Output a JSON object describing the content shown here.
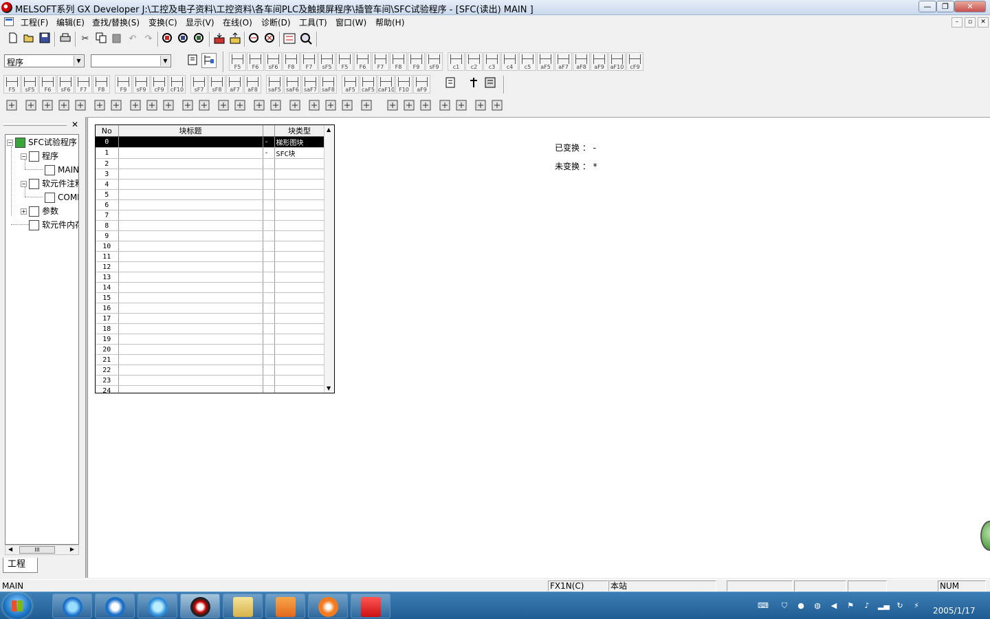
{
  "window": {
    "title": "MELSOFT系列 GX Developer J:\\工控及电子资料\\工控资料\\各车间PLC及触摸屏程序\\插管车间\\SFC试验程序 - [SFC(读出)    MAIN  ]",
    "min": "—",
    "restore": "❐",
    "close": "✕"
  },
  "menu": [
    "工程(F)",
    "编辑(E)",
    "查找/替换(S)",
    "变换(C)",
    "显示(V)",
    "在线(O)",
    "诊断(D)",
    "工具(T)",
    "窗口(W)",
    "帮助(H)"
  ],
  "mdi": {
    "min": "–",
    "restore": "▫",
    "close": "✕"
  },
  "toolbar1": [
    "new-icon",
    "open-icon",
    "save-icon",
    "print-icon",
    "cut-icon",
    "copy-icon",
    "paste-icon",
    "undo-icon",
    "redo-icon",
    "find-device-icon",
    "find-instruction-icon",
    "find-step-icon",
    "read-plc-icon",
    "write-plc-icon",
    "monitor-icon",
    "monitor-stop-icon",
    "ladder-icon",
    "zoom-icon"
  ],
  "combos": {
    "program": "程序",
    "second": ""
  },
  "sfc_keys": [
    "F5",
    "F6",
    "sF6",
    "F8",
    "F7",
    "sF5",
    "F5",
    "F6",
    "F7",
    "F8",
    "F9",
    "sF9",
    "c1",
    "c2",
    "c3",
    "c4",
    "c5",
    "aF5",
    "aF7",
    "aF8",
    "aF9",
    "aF10",
    "cF9"
  ],
  "ladder_keys": [
    "F5",
    "sF5",
    "F6",
    "sF6",
    "F7",
    "F8",
    "F9",
    "sF9",
    "cF9",
    "cF10",
    "sF7",
    "sF8",
    "aF7",
    "aF8",
    "saF5",
    "saF6",
    "saF7",
    "saF8",
    "aF5",
    "caF5",
    "caF10",
    "F10",
    "aF9"
  ],
  "tree": {
    "root": "SFC试验程序",
    "program": "程序",
    "main": "MAIN",
    "comment": "软元件注释",
    "com": "COMMENT",
    "param": "参数",
    "memory": "软元件内存",
    "tab": "工程"
  },
  "grid": {
    "headers": {
      "no": "No",
      "title": "块标题",
      "type": "块类型"
    },
    "rows": [
      {
        "no": "0",
        "title": "",
        "mark": "-",
        "type": "梯形图块"
      },
      {
        "no": "1",
        "title": "",
        "mark": "-",
        "type": "SFC块"
      },
      {
        "no": "2",
        "title": "",
        "mark": "",
        "type": ""
      },
      {
        "no": "3",
        "title": "",
        "mark": "",
        "type": ""
      },
      {
        "no": "4",
        "title": "",
        "mark": "",
        "type": ""
      },
      {
        "no": "5",
        "title": "",
        "mark": "",
        "type": ""
      },
      {
        "no": "6",
        "title": "",
        "mark": "",
        "type": ""
      },
      {
        "no": "7",
        "title": "",
        "mark": "",
        "type": ""
      },
      {
        "no": "8",
        "title": "",
        "mark": "",
        "type": ""
      },
      {
        "no": "9",
        "title": "",
        "mark": "",
        "type": ""
      },
      {
        "no": "10",
        "title": "",
        "mark": "",
        "type": ""
      },
      {
        "no": "11",
        "title": "",
        "mark": "",
        "type": ""
      },
      {
        "no": "12",
        "title": "",
        "mark": "",
        "type": ""
      },
      {
        "no": "13",
        "title": "",
        "mark": "",
        "type": ""
      },
      {
        "no": "14",
        "title": "",
        "mark": "",
        "type": ""
      },
      {
        "no": "15",
        "title": "",
        "mark": "",
        "type": ""
      },
      {
        "no": "16",
        "title": "",
        "mark": "",
        "type": ""
      },
      {
        "no": "17",
        "title": "",
        "mark": "",
        "type": ""
      },
      {
        "no": "18",
        "title": "",
        "mark": "",
        "type": ""
      },
      {
        "no": "19",
        "title": "",
        "mark": "",
        "type": ""
      },
      {
        "no": "20",
        "title": "",
        "mark": "",
        "type": ""
      },
      {
        "no": "21",
        "title": "",
        "mark": "",
        "type": ""
      },
      {
        "no": "22",
        "title": "",
        "mark": "",
        "type": ""
      },
      {
        "no": "23",
        "title": "",
        "mark": "",
        "type": ""
      },
      {
        "no": "24",
        "title": "",
        "mark": "",
        "type": ""
      }
    ],
    "selected_row": 0
  },
  "conversion": {
    "converted": "已变换 ： -",
    "unconverted": "未变换 ： *"
  },
  "status": {
    "program": "MAIN",
    "cpu": "FX1N(C)",
    "station": "本站",
    "num": "NUM"
  },
  "taskbar": {
    "time": "",
    "date": "2005/1/17"
  },
  "colors": {
    "titlebar": "#c9d9ec",
    "selection": "#000000",
    "taskbar": "#1f5c93"
  }
}
